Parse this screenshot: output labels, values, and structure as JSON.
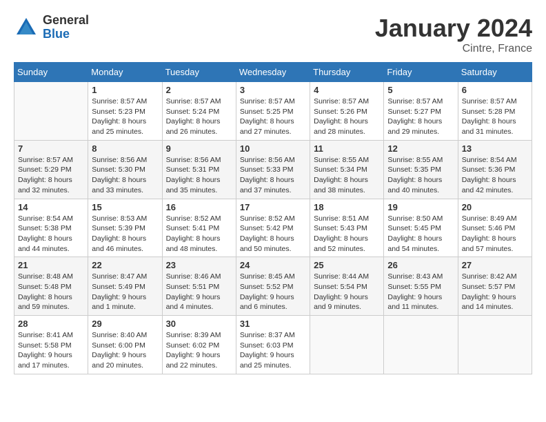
{
  "logo": {
    "general": "General",
    "blue": "Blue"
  },
  "title": "January 2024",
  "location": "Cintre, France",
  "days": [
    "Sunday",
    "Monday",
    "Tuesday",
    "Wednesday",
    "Thursday",
    "Friday",
    "Saturday"
  ],
  "weeks": [
    [
      {
        "day": "",
        "sunrise": "",
        "sunset": "",
        "daylight": ""
      },
      {
        "day": "1",
        "sunrise": "Sunrise: 8:57 AM",
        "sunset": "Sunset: 5:23 PM",
        "daylight": "Daylight: 8 hours and 25 minutes."
      },
      {
        "day": "2",
        "sunrise": "Sunrise: 8:57 AM",
        "sunset": "Sunset: 5:24 PM",
        "daylight": "Daylight: 8 hours and 26 minutes."
      },
      {
        "day": "3",
        "sunrise": "Sunrise: 8:57 AM",
        "sunset": "Sunset: 5:25 PM",
        "daylight": "Daylight: 8 hours and 27 minutes."
      },
      {
        "day": "4",
        "sunrise": "Sunrise: 8:57 AM",
        "sunset": "Sunset: 5:26 PM",
        "daylight": "Daylight: 8 hours and 28 minutes."
      },
      {
        "day": "5",
        "sunrise": "Sunrise: 8:57 AM",
        "sunset": "Sunset: 5:27 PM",
        "daylight": "Daylight: 8 hours and 29 minutes."
      },
      {
        "day": "6",
        "sunrise": "Sunrise: 8:57 AM",
        "sunset": "Sunset: 5:28 PM",
        "daylight": "Daylight: 8 hours and 31 minutes."
      }
    ],
    [
      {
        "day": "7",
        "sunrise": "Sunrise: 8:57 AM",
        "sunset": "Sunset: 5:29 PM",
        "daylight": "Daylight: 8 hours and 32 minutes."
      },
      {
        "day": "8",
        "sunrise": "Sunrise: 8:56 AM",
        "sunset": "Sunset: 5:30 PM",
        "daylight": "Daylight: 8 hours and 33 minutes."
      },
      {
        "day": "9",
        "sunrise": "Sunrise: 8:56 AM",
        "sunset": "Sunset: 5:31 PM",
        "daylight": "Daylight: 8 hours and 35 minutes."
      },
      {
        "day": "10",
        "sunrise": "Sunrise: 8:56 AM",
        "sunset": "Sunset: 5:33 PM",
        "daylight": "Daylight: 8 hours and 37 minutes."
      },
      {
        "day": "11",
        "sunrise": "Sunrise: 8:55 AM",
        "sunset": "Sunset: 5:34 PM",
        "daylight": "Daylight: 8 hours and 38 minutes."
      },
      {
        "day": "12",
        "sunrise": "Sunrise: 8:55 AM",
        "sunset": "Sunset: 5:35 PM",
        "daylight": "Daylight: 8 hours and 40 minutes."
      },
      {
        "day": "13",
        "sunrise": "Sunrise: 8:54 AM",
        "sunset": "Sunset: 5:36 PM",
        "daylight": "Daylight: 8 hours and 42 minutes."
      }
    ],
    [
      {
        "day": "14",
        "sunrise": "Sunrise: 8:54 AM",
        "sunset": "Sunset: 5:38 PM",
        "daylight": "Daylight: 8 hours and 44 minutes."
      },
      {
        "day": "15",
        "sunrise": "Sunrise: 8:53 AM",
        "sunset": "Sunset: 5:39 PM",
        "daylight": "Daylight: 8 hours and 46 minutes."
      },
      {
        "day": "16",
        "sunrise": "Sunrise: 8:52 AM",
        "sunset": "Sunset: 5:41 PM",
        "daylight": "Daylight: 8 hours and 48 minutes."
      },
      {
        "day": "17",
        "sunrise": "Sunrise: 8:52 AM",
        "sunset": "Sunset: 5:42 PM",
        "daylight": "Daylight: 8 hours and 50 minutes."
      },
      {
        "day": "18",
        "sunrise": "Sunrise: 8:51 AM",
        "sunset": "Sunset: 5:43 PM",
        "daylight": "Daylight: 8 hours and 52 minutes."
      },
      {
        "day": "19",
        "sunrise": "Sunrise: 8:50 AM",
        "sunset": "Sunset: 5:45 PM",
        "daylight": "Daylight: 8 hours and 54 minutes."
      },
      {
        "day": "20",
        "sunrise": "Sunrise: 8:49 AM",
        "sunset": "Sunset: 5:46 PM",
        "daylight": "Daylight: 8 hours and 57 minutes."
      }
    ],
    [
      {
        "day": "21",
        "sunrise": "Sunrise: 8:48 AM",
        "sunset": "Sunset: 5:48 PM",
        "daylight": "Daylight: 8 hours and 59 minutes."
      },
      {
        "day": "22",
        "sunrise": "Sunrise: 8:47 AM",
        "sunset": "Sunset: 5:49 PM",
        "daylight": "Daylight: 9 hours and 1 minute."
      },
      {
        "day": "23",
        "sunrise": "Sunrise: 8:46 AM",
        "sunset": "Sunset: 5:51 PM",
        "daylight": "Daylight: 9 hours and 4 minutes."
      },
      {
        "day": "24",
        "sunrise": "Sunrise: 8:45 AM",
        "sunset": "Sunset: 5:52 PM",
        "daylight": "Daylight: 9 hours and 6 minutes."
      },
      {
        "day": "25",
        "sunrise": "Sunrise: 8:44 AM",
        "sunset": "Sunset: 5:54 PM",
        "daylight": "Daylight: 9 hours and 9 minutes."
      },
      {
        "day": "26",
        "sunrise": "Sunrise: 8:43 AM",
        "sunset": "Sunset: 5:55 PM",
        "daylight": "Daylight: 9 hours and 11 minutes."
      },
      {
        "day": "27",
        "sunrise": "Sunrise: 8:42 AM",
        "sunset": "Sunset: 5:57 PM",
        "daylight": "Daylight: 9 hours and 14 minutes."
      }
    ],
    [
      {
        "day": "28",
        "sunrise": "Sunrise: 8:41 AM",
        "sunset": "Sunset: 5:58 PM",
        "daylight": "Daylight: 9 hours and 17 minutes."
      },
      {
        "day": "29",
        "sunrise": "Sunrise: 8:40 AM",
        "sunset": "Sunset: 6:00 PM",
        "daylight": "Daylight: 9 hours and 20 minutes."
      },
      {
        "day": "30",
        "sunrise": "Sunrise: 8:39 AM",
        "sunset": "Sunset: 6:02 PM",
        "daylight": "Daylight: 9 hours and 22 minutes."
      },
      {
        "day": "31",
        "sunrise": "Sunrise: 8:37 AM",
        "sunset": "Sunset: 6:03 PM",
        "daylight": "Daylight: 9 hours and 25 minutes."
      },
      {
        "day": "",
        "sunrise": "",
        "sunset": "",
        "daylight": ""
      },
      {
        "day": "",
        "sunrise": "",
        "sunset": "",
        "daylight": ""
      },
      {
        "day": "",
        "sunrise": "",
        "sunset": "",
        "daylight": ""
      }
    ]
  ]
}
